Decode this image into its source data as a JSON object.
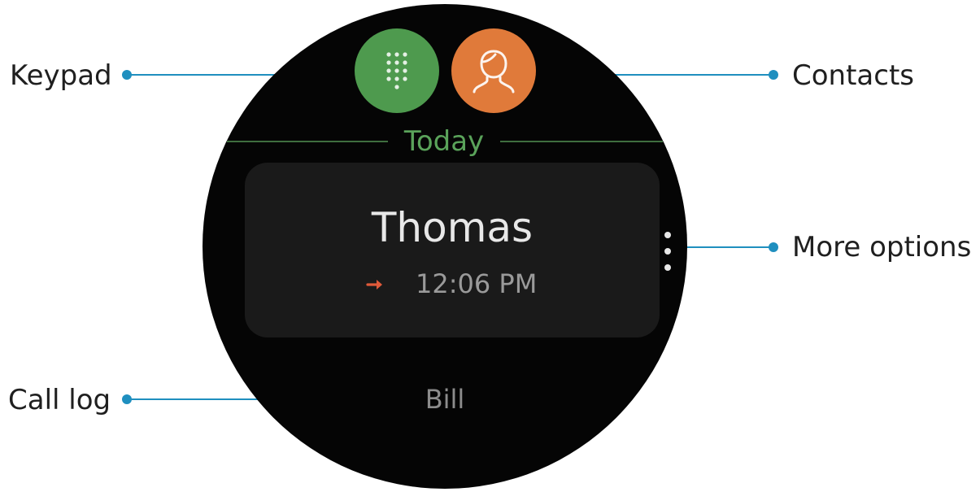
{
  "screen": {
    "section_header": "Today",
    "recent_call": {
      "name": "Thomas",
      "time": "12:06 PM",
      "direction_icon": "outgoing-call-arrow-icon"
    },
    "next_call": {
      "name": "Bill"
    },
    "keypad_button": {
      "icon": "dialpad-icon"
    },
    "contacts_button": {
      "icon": "person-icon"
    },
    "more_options": {
      "icon": "vertical-dots-icon"
    }
  },
  "callouts": {
    "keypad": "Keypad",
    "contacts": "Contacts",
    "more_options": "More options",
    "call_log": "Call log"
  },
  "colors": {
    "watch_background": "#050505",
    "keypad_green": "#4e9a4e",
    "contacts_orange": "#e07a3a",
    "header_green": "#5aa35a",
    "leader_blue": "#1f8fbf",
    "outgoing_arrow": "#e05a3a"
  }
}
